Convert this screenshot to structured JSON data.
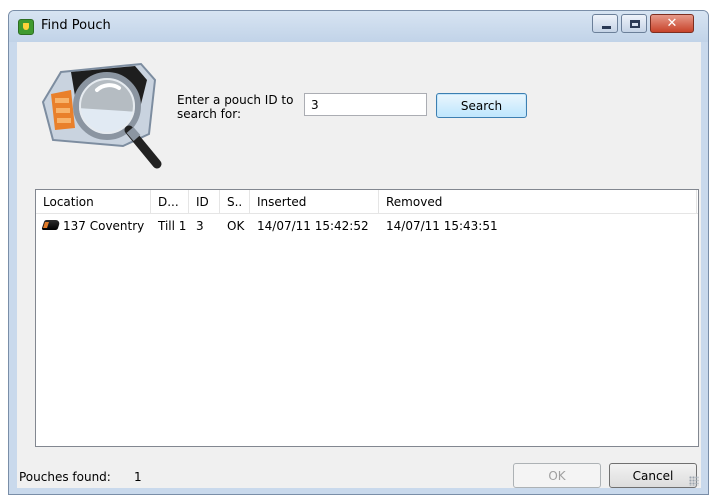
{
  "window": {
    "title": "Find Pouch"
  },
  "search": {
    "prompt": "Enter a pouch ID to search for:",
    "value": "3",
    "button_label": "Search"
  },
  "table": {
    "columns": [
      "Location",
      "D...",
      "ID",
      "S..",
      "Inserted",
      "Removed"
    ],
    "rows": [
      {
        "location": "137 Coventry",
        "device": "Till 1",
        "id": "3",
        "status": "OK",
        "inserted": "14/07/11 15:42:52",
        "removed": "14/07/11 15:43:51"
      }
    ]
  },
  "footer": {
    "found_label": "Pouches found:",
    "found_count": "1",
    "ok_label": "OK",
    "cancel_label": "Cancel"
  },
  "colors": {
    "titlebar": "#c9d9ec",
    "client_bg": "#f0f0f0",
    "search_button": "#bee6fd",
    "close_button": "#c7432a"
  },
  "icons": [
    "app-shield-icon",
    "minimize-icon",
    "maximize-icon",
    "close-icon",
    "pouch-magnifier-logo",
    "pouch-icon",
    "resize-grip-icon"
  ]
}
